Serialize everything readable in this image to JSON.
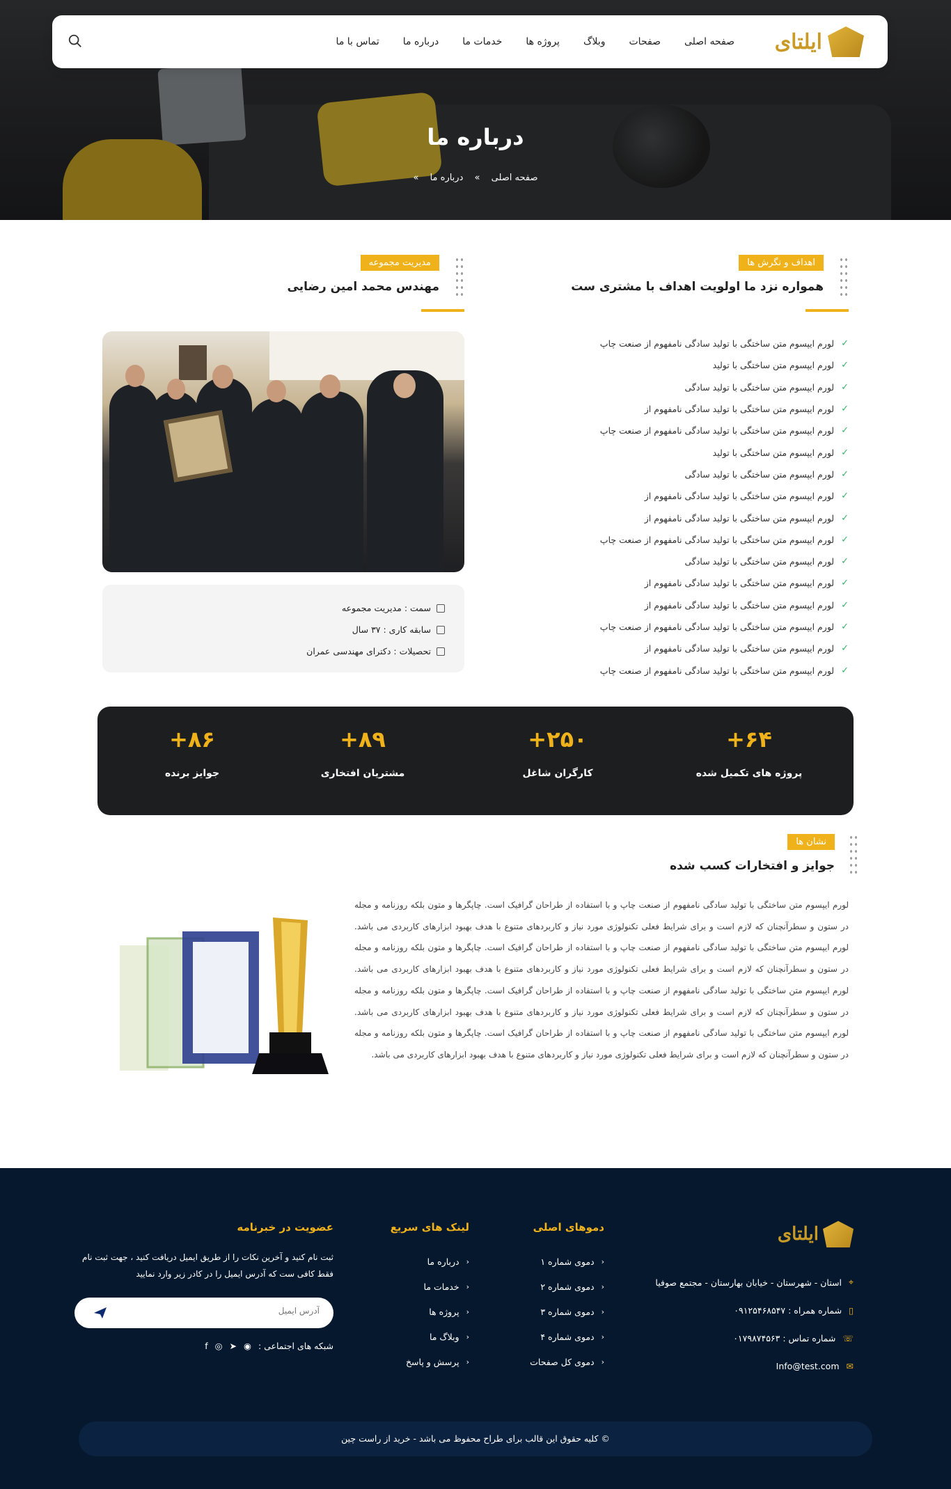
{
  "header": {
    "logo_text": "ایلتای",
    "menu": [
      "صفحه اصلی",
      "صفحات",
      "وبلاگ",
      "پروژه ها",
      "خدمات ما",
      "درباره ما",
      "تماس با ما"
    ]
  },
  "hero": {
    "title": "درباره ما",
    "breadcrumb": [
      "صفحه اصلی",
      "درباره ما"
    ],
    "separator": "»"
  },
  "goals": {
    "tag": "اهداف و نگرش ها",
    "title": "همواره نزد ما اولویت اهداف با مشتری ست",
    "items": [
      "لورم ایپسوم متن ساختگی با تولید سادگی نامفهوم از صنعت چاپ",
      "لورم ایپسوم متن ساختگی با تولید",
      "لورم ایپسوم متن ساختگی با تولید سادگی",
      "لورم ایپسوم متن ساختگی با تولید سادگی نامفهوم از",
      "لورم ایپسوم متن ساختگی با تولید سادگی نامفهوم از صنعت چاپ",
      "لورم ایپسوم متن ساختگی با تولید",
      "لورم ایپسوم متن ساختگی با تولید سادگی",
      "لورم ایپسوم متن ساختگی با تولید سادگی نامفهوم از",
      "لورم ایپسوم متن ساختگی با تولید سادگی نامفهوم از",
      "لورم ایپسوم متن ساختگی با تولید سادگی نامفهوم از صنعت چاپ",
      "لورم ایپسوم متن ساختگی با تولید سادگی",
      "لورم ایپسوم متن ساختگی با تولید سادگی نامفهوم از",
      "لورم ایپسوم متن ساختگی با تولید سادگی نامفهوم از",
      "لورم ایپسوم متن ساختگی با تولید سادگی نامفهوم از صنعت چاپ",
      "لورم ایپسوم متن ساختگی با تولید سادگی نامفهوم از",
      "لورم ایپسوم متن ساختگی با تولید سادگی نامفهوم از صنعت چاپ"
    ]
  },
  "manager": {
    "tag": "مدیریت مجموعه",
    "name": "مهندس محمد امین رضایی",
    "role": "سمت : مدیریت مجموعه",
    "experience": "سابقه کاری : ۳۷ سال",
    "education": "تحصیلات : دکترای مهندسی عمران"
  },
  "stats": [
    {
      "value": "+۶۴",
      "label": "پروژه های تکمیل شده"
    },
    {
      "value": "+۲۵۰",
      "label": "کارگران شاغل"
    },
    {
      "value": "+۸۹",
      "label": "مشتریان افتخاری"
    },
    {
      "value": "+۸۶",
      "label": "جوایز برنده"
    }
  ],
  "awards": {
    "tag": "نشان ها",
    "title": "جوایز و افتخارات کسب شده",
    "paragraph": "لورم ایپسوم متن ساختگی با تولید سادگی نامفهوم از صنعت چاپ و با استفاده از طراحان گرافیک است. چاپگرها و متون بلکه روزنامه و مجله در ستون و سطرآنچنان که لازم است و برای شرایط فعلی تکنولوژی مورد نیاز و کاربردهای متنوع با هدف بهبود ابزارهای کاربردی می باشد. لورم ایپسوم متن ساختگی با تولید سادگی نامفهوم از صنعت چاپ و با استفاده از طراحان گرافیک است. چاپگرها و متون بلکه روزنامه و مجله در ستون و سطرآنچنان که لازم است و برای شرایط فعلی تکنولوژی مورد نیاز و کاربردهای متنوع با هدف بهبود ابزارهای کاربردی می باشد. لورم ایپسوم متن ساختگی با تولید سادگی نامفهوم از صنعت چاپ و با استفاده از طراحان گرافیک است. چاپگرها و متون بلکه روزنامه و مجله در ستون و سطرآنچنان که لازم است و برای شرایط فعلی تکنولوژی مورد نیاز و کاربردهای متنوع با هدف بهبود ابزارهای کاربردی می باشد. لورم ایپسوم متن ساختگی با تولید سادگی نامفهوم از صنعت چاپ و با استفاده از طراحان گرافیک است. چاپگرها و متون بلکه روزنامه و مجله در ستون و سطرآنچنان که لازم است و برای شرایط فعلی تکنولوژی مورد نیاز و کاربردهای متنوع با هدف بهبود ابزارهای کاربردی می باشد."
  },
  "footer": {
    "logo_text": "ایلتای",
    "address": "استان - شهرستان - خیابان بهارستان - مجتمع صوفیا",
    "mobile": "شماره همراه : ۰۹۱۲۵۴۶۸۵۴۷",
    "phone": "شماره تماس : ۰۱۷۹۸۷۴۵۶۳",
    "email": "Info@test.com",
    "demos_title": "دموهای اصلی",
    "demos": [
      "دموی شماره ۱",
      "دموی شماره ۲",
      "دموی شماره ۳",
      "دموی شماره ۴",
      "دموی کل صفحات"
    ],
    "links_title": "لینک های سریع",
    "links": [
      "درباره ما",
      "خدمات ما",
      "پروژه ها",
      "وبلاگ ما",
      "پرسش و پاسخ"
    ],
    "newsletter_title": "عضویت در خبرنامه",
    "newsletter_text": "ثبت نام کنید و آخرین نکات را از طریق ایمیل دریافت کنید ، جهت ثبت نام فقط کافی ست که آدرس ایمیل را در کادر زیر وارد نمایید",
    "email_placeholder": "آدرس ایمیل",
    "social_label": "شبکه های اجتماعی :",
    "copyright": "© کلیه حقوق این قالب برای طراح محفوظ می باشد - خرید از راست چین"
  },
  "colors": {
    "accent": "#f0b21b",
    "dark": "#1d1e20",
    "footer": "#06182e",
    "check": "#3bb36a"
  }
}
